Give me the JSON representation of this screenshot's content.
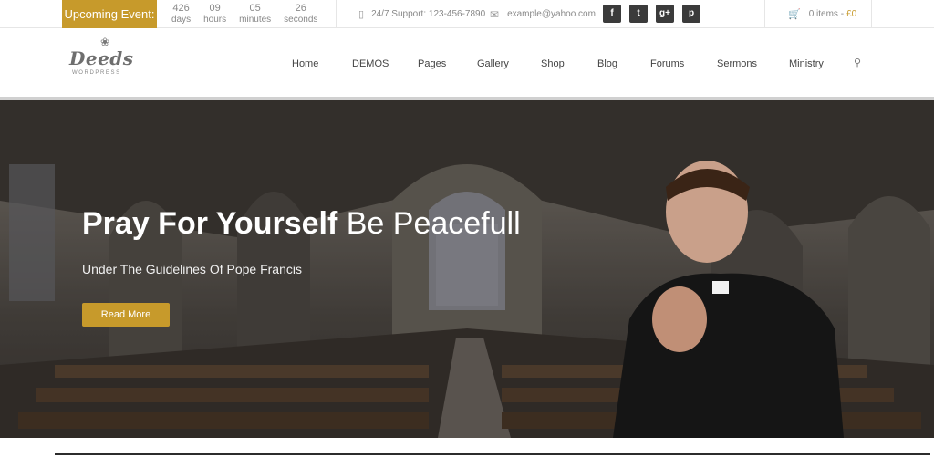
{
  "topbar": {
    "event_label": "Upcoming Event:",
    "countdown": [
      {
        "value": "426",
        "unit": "days"
      },
      {
        "value": "09",
        "unit": "hours"
      },
      {
        "value": "05",
        "unit": "minutes"
      },
      {
        "value": "26",
        "unit": "seconds"
      }
    ],
    "support": "24/7 Support: 123-456-7890",
    "email": "example@yahoo.com",
    "social": [
      {
        "icon": "facebook-icon",
        "glyph": "f"
      },
      {
        "icon": "twitter-icon",
        "glyph": "t"
      },
      {
        "icon": "google-plus-icon",
        "glyph": "g+"
      },
      {
        "icon": "pinterest-icon",
        "glyph": "p"
      }
    ],
    "cart_items": "0 items -",
    "cart_total": "£0"
  },
  "header": {
    "logo_name": "Deeds",
    "logo_sub": "WORDPRESS",
    "nav": [
      "Home",
      "DEMOS",
      "Pages",
      "Gallery",
      "Shop",
      "Blog",
      "Forums",
      "Sermons",
      "Ministry"
    ]
  },
  "hero": {
    "title_bold": "Pray For Yourself",
    "title_light": "Be Peacefull",
    "subtitle": "Under The Guidelines Of Pope Francis",
    "button": "Read More"
  },
  "colors": {
    "accent": "#c79a2b",
    "dark": "#3b3b3b"
  }
}
